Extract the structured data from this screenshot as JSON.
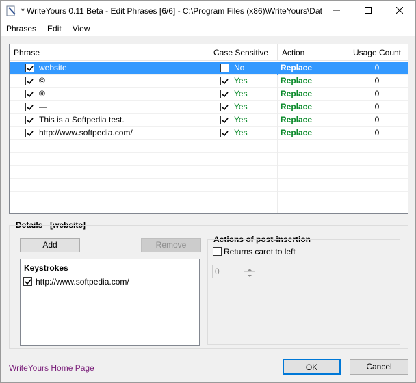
{
  "window": {
    "title": "* WriteYours 0.11 Beta - Edit Phrases [6/6] - C:\\Program Files (x86)\\WriteYours\\Dat..."
  },
  "menu": [
    "Phrases",
    "Edit",
    "View"
  ],
  "grid": {
    "columns": [
      "Phrase",
      "Case Sensitive",
      "Action",
      "Usage Count"
    ],
    "rows": [
      {
        "phrase": "website",
        "case": "No",
        "action": "Replace",
        "usage": "0",
        "checked": true,
        "case_checked": false,
        "selected": true
      },
      {
        "phrase": "©",
        "case": "Yes",
        "action": "Replace",
        "usage": "0",
        "checked": true,
        "case_checked": true,
        "selected": false
      },
      {
        "phrase": "®",
        "case": "Yes",
        "action": "Replace",
        "usage": "0",
        "checked": true,
        "case_checked": true,
        "selected": false
      },
      {
        "phrase": "—",
        "case": "Yes",
        "action": "Replace",
        "usage": "0",
        "checked": true,
        "case_checked": true,
        "selected": false
      },
      {
        "phrase": "This is a Softpedia test.",
        "case": "Yes",
        "action": "Replace",
        "usage": "0",
        "checked": true,
        "case_checked": true,
        "selected": false
      },
      {
        "phrase": "http://www.softpedia.com/",
        "case": "Yes",
        "action": "Replace",
        "usage": "0",
        "checked": true,
        "case_checked": true,
        "selected": false
      }
    ]
  },
  "details": {
    "title": "Details - [website]",
    "add_label": "Add",
    "remove_label": "Remove",
    "keystrokes_title": "Keystrokes",
    "keystroke_item": "http://www.softpedia.com/",
    "post_title": "Actions of post-insertion",
    "returns_caret_label": "Returns caret to left",
    "spin_value": "0"
  },
  "footer": {
    "home_link": "WriteYours Home Page",
    "ok_label": "OK",
    "cancel_label": "Cancel"
  },
  "colors": {
    "selection": "#3399ff",
    "yes_green": "#0a8a2a",
    "link": "#7a1f7a"
  }
}
